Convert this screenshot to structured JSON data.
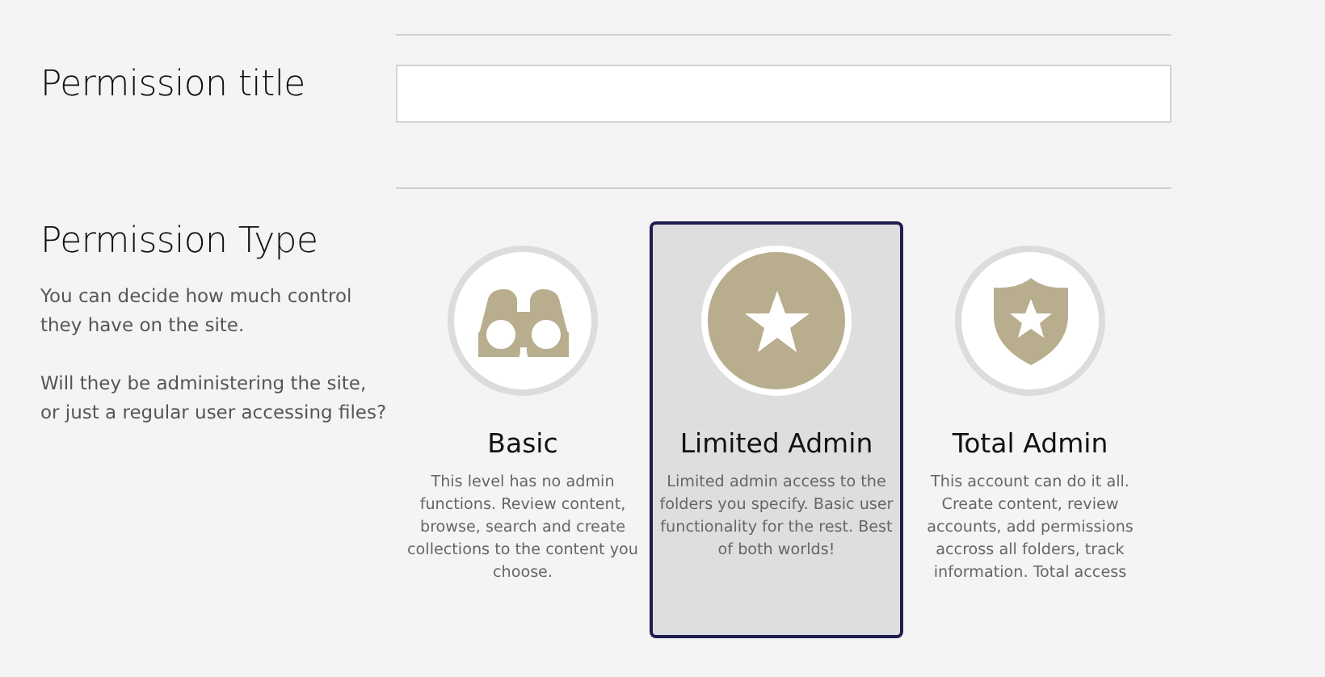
{
  "title_field": {
    "label": "Permission title"
  },
  "permission_type": {
    "heading": "Permission Type",
    "paragraphs": [
      "You can decide how much control they have on the site.",
      "Will they be administering the site, or just a regular user accessing files?"
    ],
    "options": [
      {
        "kind": "binoculars",
        "title": "Basic",
        "description": "This level has no admin functions. Review content, browse, search and create collections to the content you choose.",
        "selected": false
      },
      {
        "kind": "star",
        "title": "Limited Admin",
        "description": "Limited admin access to the folders you specify. Basic user functionality for the rest. Best of both worlds!",
        "selected": true
      },
      {
        "kind": "shield",
        "title": "Total Admin",
        "description": "This account can do it all. Create content, review accounts, add permissions accross all folders, track information. Total access",
        "selected": false
      }
    ]
  }
}
